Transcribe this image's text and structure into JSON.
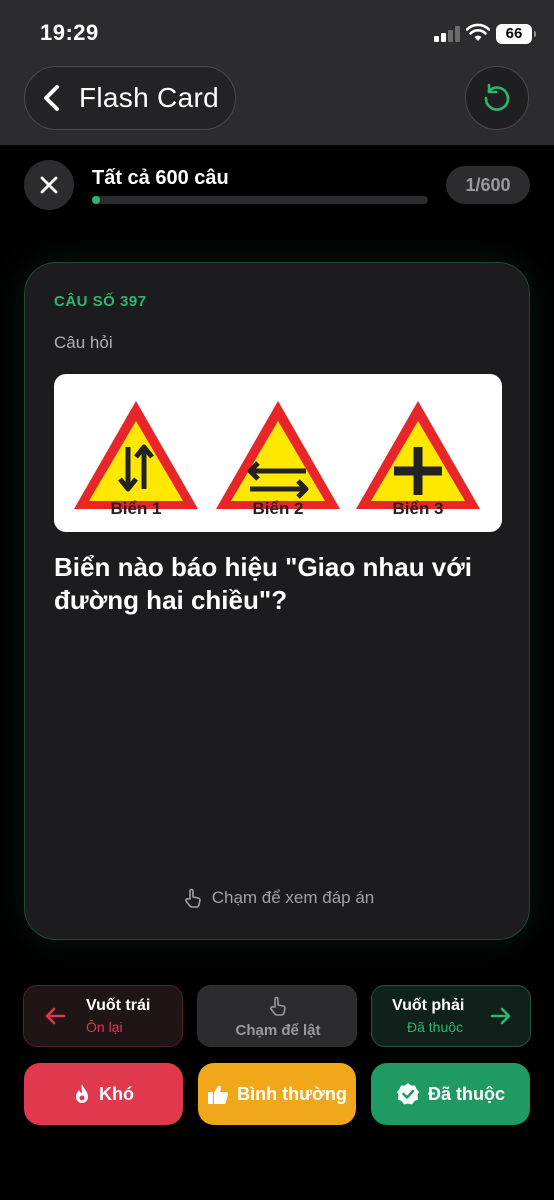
{
  "status_bar": {
    "time": "19:29",
    "battery": "66"
  },
  "header": {
    "title": "Flash Card",
    "back_icon": "chevron-left-icon",
    "reset_icon": "refresh-icon"
  },
  "progress": {
    "title": "Tất cả 600 câu",
    "counter": "1/600",
    "fraction": 0.0017
  },
  "card": {
    "question_number": "CÂU SỐ 397",
    "question_label": "Câu hỏi",
    "signs": [
      {
        "caption": "Biển 1",
        "icon": "two-way-traffic-sign-icon"
      },
      {
        "caption": "Biển 2",
        "icon": "two-way-intersection-sign-icon"
      },
      {
        "caption": "Biển 3",
        "icon": "crossroad-sign-icon"
      }
    ],
    "question_text": "Biển nào báo hiệu \"Giao nhau với đường hai chiều\"?",
    "tap_hint": "Chạm để xem đáp án"
  },
  "swipe": {
    "left": {
      "title": "Vuốt trái",
      "subtitle": "Ôn lại"
    },
    "middle": {
      "label": "Chạm để lật"
    },
    "right": {
      "title": "Vuốt phải",
      "subtitle": "Đã thuộc"
    }
  },
  "actions": {
    "hard": "Khó",
    "normal": "Bình thường",
    "known": "Đã thuộc"
  },
  "colors": {
    "accent_green": "#2bb673",
    "hard_red": "#e0384d",
    "normal_orange": "#f0a81a",
    "known_green": "#1f9a62"
  }
}
